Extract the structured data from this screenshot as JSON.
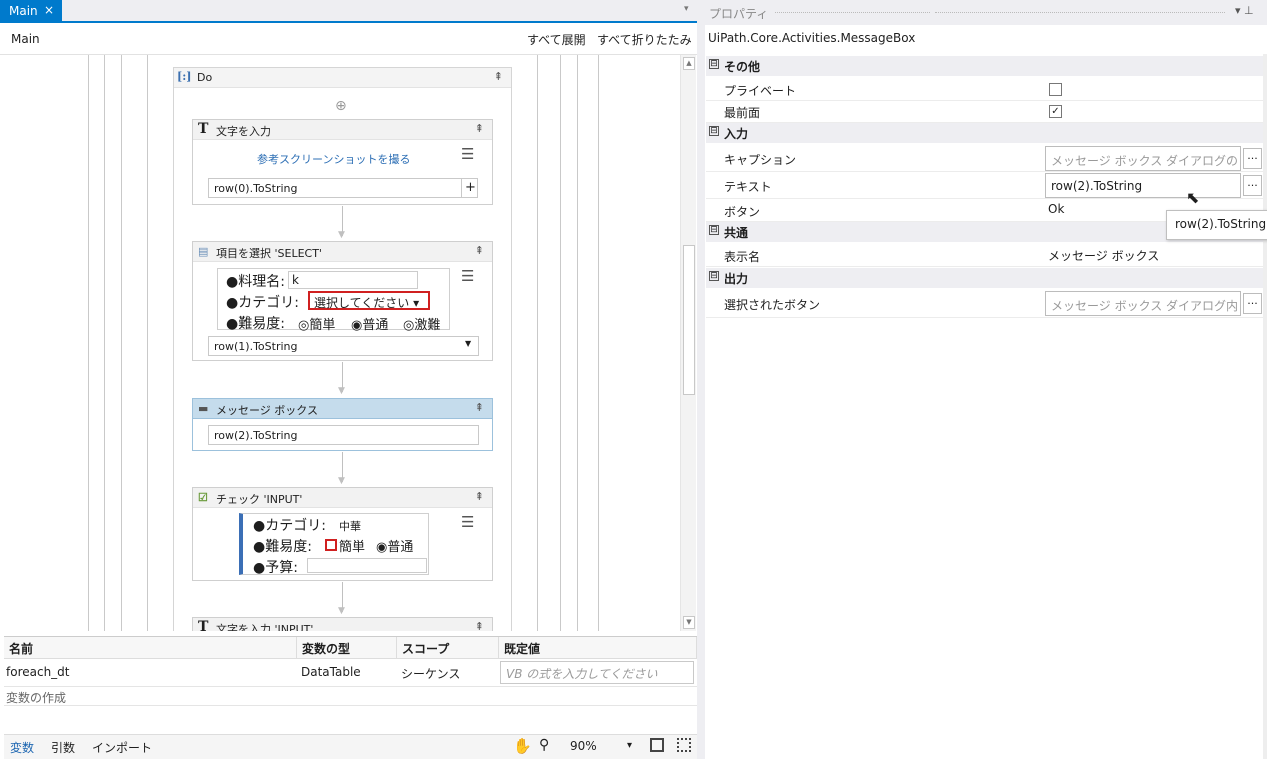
{
  "tab": {
    "label": "Main",
    "close": "×",
    "dropdown": "▾"
  },
  "breadcrumb": "Main",
  "toolbar": {
    "expand_all": "すべて展開",
    "collapse_all": "すべて折りたたみ"
  },
  "do_block": {
    "title": "Do",
    "collapse": "⇞",
    "add": "⊕"
  },
  "act_type1": {
    "title": "文字を入力",
    "icon": "T",
    "link": "参考スクリーンショットを撮る",
    "field": "row(0).ToString",
    "plus": "+"
  },
  "act_select": {
    "title": "項目を選択 'SELECT'",
    "field": "row(1).ToString",
    "preview": {
      "name_label": "●料理名:",
      "name_value": "k",
      "cat_label": "●カテゴリ:",
      "cat_value": "選択してください ▾",
      "diff_label": "●難易度:",
      "opt1": "◎簡単",
      "opt2": "◉普通",
      "opt3": "◎激難"
    }
  },
  "act_msgbox": {
    "title": "メッセージ ボックス",
    "field": "row(2).ToString"
  },
  "act_check": {
    "title": "チェック 'INPUT'",
    "preview": {
      "cat_label": "●カテゴリ:",
      "cat_value": "中華",
      "diff_label": "●難易度:",
      "opt1": "簡単",
      "opt2": "◉普通",
      "budget_label": "●予算:"
    }
  },
  "act_type2": {
    "title": "文字を入力 'INPUT'",
    "icon": "T"
  },
  "variables": {
    "headers": [
      "名前",
      "変数の型",
      "スコープ",
      "既定値"
    ],
    "row": {
      "name": "foreach_dt",
      "type": "DataTable",
      "scope": "シーケンス",
      "default_placeholder": "VB の式を入力してください"
    },
    "create": "変数の作成"
  },
  "bottom": {
    "tabs": [
      "変数",
      "引数",
      "インポート"
    ],
    "zoom": "90%",
    "zoom_dd": "▾",
    "pan_icon": "hand-icon",
    "search_icon": "search-icon"
  },
  "properties": {
    "title": "プロパティ",
    "pin": "▾ ⊥",
    "class": "UiPath.Core.Activities.MessageBox",
    "categories": {
      "misc": "その他",
      "input": "入力",
      "common": "共通",
      "output": "出力"
    },
    "private": "プライベート",
    "topmost": "最前面",
    "topmost_check": "✓",
    "caption": "キャプション",
    "caption_ph": "メッセージ ボックス ダイアログの",
    "text": "テキスト",
    "text_value": "row(2).ToString",
    "buttons": "ボタン",
    "buttons_value": "Ok",
    "display_name": "表示名",
    "display_name_value": "メッセージ ボックス",
    "selected_button": "選択されたボタン",
    "selected_button_ph": "メッセージ ボックス ダイアログ内",
    "ellipsis": "...",
    "toggle": "⊟"
  },
  "tooltip": "row(2).ToString",
  "colors": {
    "accent": "#007acc",
    "selected_header": "#c5dcec",
    "red_outline": "#d02020"
  }
}
